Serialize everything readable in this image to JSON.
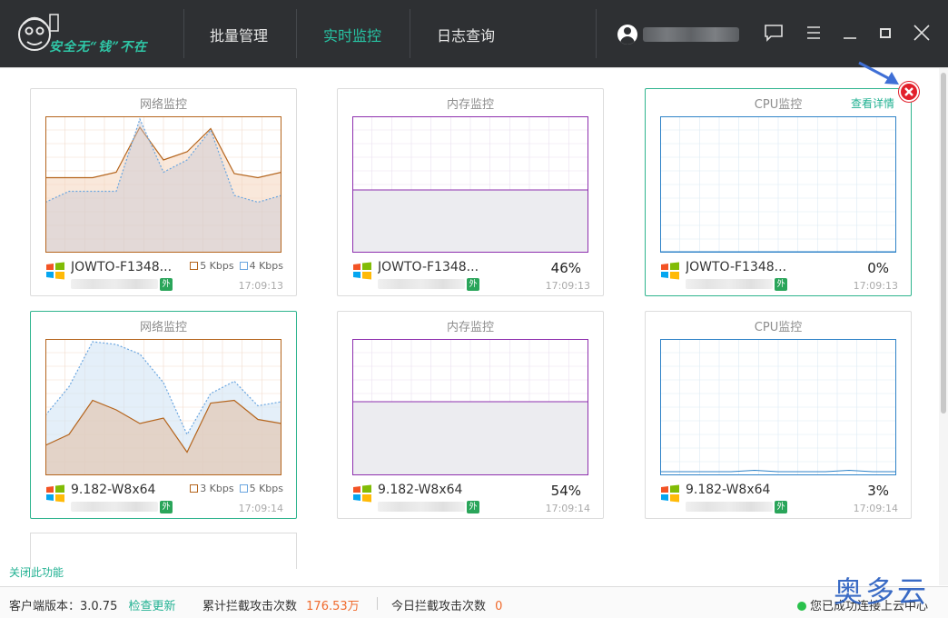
{
  "app": {
    "slogan": "安全无“钱”不在",
    "nav": [
      "批量管理",
      "实时监控",
      "日志查询"
    ],
    "active_nav": 1
  },
  "cards": [
    {
      "title": "网络监控",
      "host": "JOWTO-F1348...",
      "tag": "外",
      "time": "17:09:13",
      "type": "network",
      "legend": [
        {
          "label": "5 Kbps",
          "color": "#b5651d"
        },
        {
          "label": "4 Kbps",
          "color": "#6aa6e0"
        }
      ],
      "series_out": [
        5.5,
        5.5,
        5.5,
        5.9,
        9.2,
        6.8,
        7.4,
        9.1,
        5.8,
        5.5,
        5.9
      ],
      "series_in": [
        3.7,
        4.5,
        4.5,
        4.5,
        9.8,
        5.9,
        6.8,
        9.0,
        4.2,
        3.7,
        4.2
      ],
      "max": 10,
      "theme": "#b5651d"
    },
    {
      "title": "内存监控",
      "host": "JOWTO-F1348...",
      "tag": "外",
      "time": "17:09:13",
      "type": "memory",
      "percent_label": "46%",
      "percent": 46,
      "theme": "#8e2fae"
    },
    {
      "title": "CPU监控",
      "link": "查看详情",
      "host": "JOWTO-F1348...",
      "tag": "外",
      "time": "17:09:13",
      "type": "cpu",
      "percent_label": "0%",
      "percent": 0,
      "series": [
        0,
        0,
        0,
        0,
        0,
        0,
        0,
        0,
        0,
        0,
        0
      ],
      "theme": "#2f83c8",
      "selected": true
    },
    {
      "title": "网络监控",
      "host": "9.182-W8x64",
      "tag": "外",
      "time": "17:09:14",
      "type": "network",
      "legend": [
        {
          "label": "3 Kbps",
          "color": "#b5651d"
        },
        {
          "label": "5 Kbps",
          "color": "#6aa6e0"
        }
      ],
      "series_out": [
        2.2,
        3.0,
        5.5,
        4.8,
        3.8,
        4.2,
        1.7,
        5.3,
        5.5,
        4.1,
        3.8
      ],
      "series_in": [
        4.4,
        6.5,
        9.8,
        9.6,
        8.9,
        6.8,
        3.0,
        6.0,
        6.9,
        5.1,
        5.4
      ],
      "max": 10,
      "theme": "#b5651d",
      "selected": true
    },
    {
      "title": "内存监控",
      "host": "9.182-W8x64",
      "tag": "外",
      "time": "17:09:14",
      "type": "memory",
      "percent_label": "54%",
      "percent": 54,
      "theme": "#8e2fae"
    },
    {
      "title": "CPU监控",
      "host": "9.182-W8x64",
      "tag": "外",
      "time": "17:09:14",
      "type": "cpu",
      "percent_label": "3%",
      "percent": 3,
      "series": [
        2,
        2,
        2,
        2,
        3,
        2,
        2,
        2,
        3,
        2,
        2
      ],
      "theme": "#2f83c8"
    }
  ],
  "close_feature": "关闭此功能",
  "status": {
    "version_label": "客户端版本：3.0.75",
    "check_update": "检查更新",
    "total_blocked_label": "累计拦截攻击次数",
    "total_blocked_value": "176.53万",
    "today_blocked_label": "今日拦截攻击次数",
    "today_blocked_value": "0",
    "connection": "您已成功连接上云中心"
  },
  "watermark": "奥多云"
}
